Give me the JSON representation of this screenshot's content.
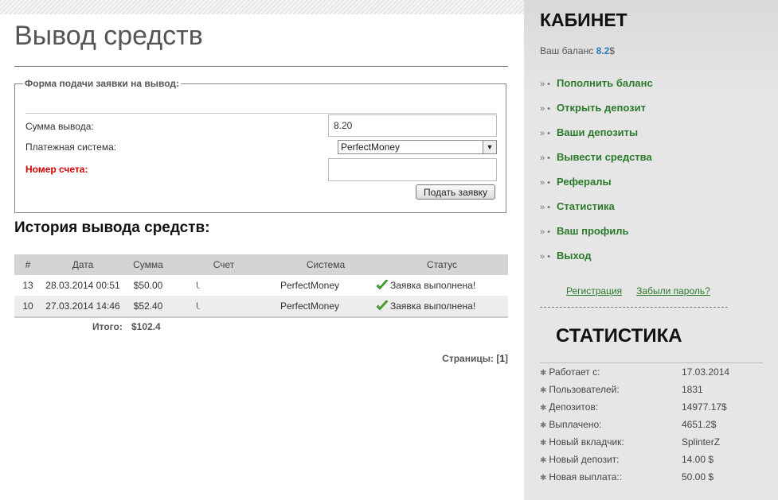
{
  "page": {
    "title": "Вывод средств"
  },
  "form": {
    "legend": "Форма подачи заявки на вывод:",
    "amount_label": "Сумма вывода:",
    "amount_value": "8.20",
    "payment_label": "Платежная система:",
    "payment_value": "PerfectMoney",
    "account_label": "Номер счета:",
    "account_value": "",
    "submit_label": "Подать заявку"
  },
  "history": {
    "title": "История вывода средств:",
    "columns": [
      "#",
      "Дата",
      "Сумма",
      "Счет",
      "Система",
      "Статус"
    ],
    "rows": [
      {
        "id": "13",
        "date": "28.03.2014 00:51",
        "amount": "$50.00",
        "account": "U",
        "system": "PerfectMoney",
        "status": "Заявка выполнена!"
      },
      {
        "id": "10",
        "date": "27.03.2014 14:46",
        "amount": "$52.40",
        "account": "U",
        "system": "PerfectMoney",
        "status": "Заявка выполнена!"
      }
    ],
    "total_label": "Итого:",
    "total_value": "$102.4",
    "pages_label": "Страницы:",
    "pages_open": "[",
    "current_page": "1",
    "pages_close": "]"
  },
  "sidebar": {
    "title": "КАБИНЕТ",
    "balance_label": "Ваш баланс",
    "balance_value": "8.2",
    "balance_currency": "$",
    "menu_bullets": "» •",
    "menu": [
      "Пополнить баланс",
      "Открыть депозит",
      "Ваши депозиты",
      "Вывести средства",
      "Рефералы",
      "Статистика",
      "Ваш профиль",
      "Выход"
    ],
    "register_link": "Регистрация",
    "forgot_link": "Забыли пароль?",
    "stats_title": "СТАТИСТИКА",
    "stats": [
      {
        "label": "Работает с:",
        "value": "17.03.2014"
      },
      {
        "label": "Пользователей:",
        "value": "1831"
      },
      {
        "label": "Депозитов:",
        "value": "14977.17$"
      },
      {
        "label": "Выплачено:",
        "value": "4651.2$"
      },
      {
        "label": "Новый вкладчик:",
        "value": "SplinterZ"
      },
      {
        "label": "Новый депозит:",
        "value": "14.00 $"
      },
      {
        "label": "Новая выплата::",
        "value": "50.00 $"
      }
    ]
  },
  "icons": {
    "status": "check-icon",
    "select": "chevron-down-icon",
    "stat_bullet": "star-icon"
  },
  "colors": {
    "link_green": "#2b7a2b",
    "required_red": "#d40000",
    "balance_blue": "#2a7ab8",
    "check_green": "#4aa82a"
  }
}
